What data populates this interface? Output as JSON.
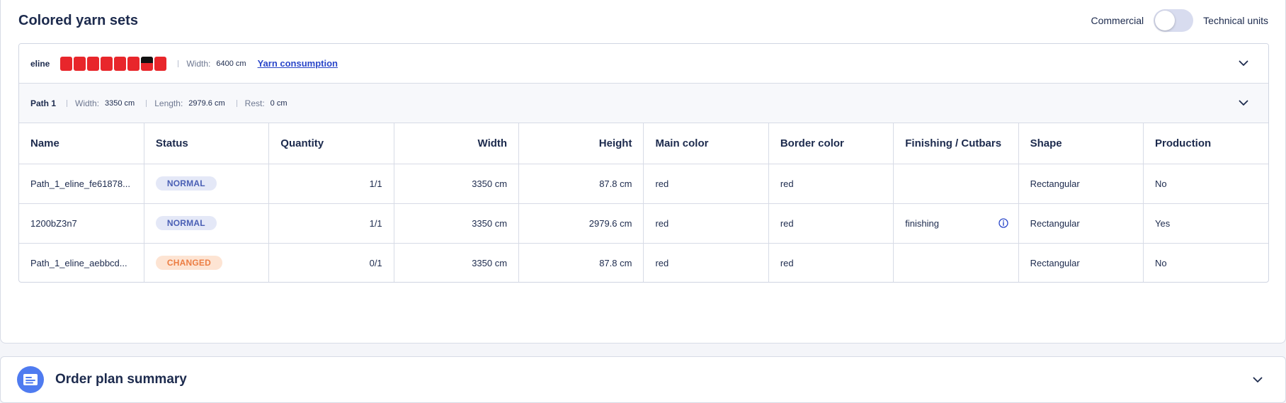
{
  "panel": {
    "title": "Colored yarn sets",
    "toggle": {
      "left_label": "Commercial",
      "right_label": "Technical units"
    }
  },
  "yarn_set": {
    "name": "eline",
    "swatches": [
      "red",
      "red",
      "red",
      "red",
      "red",
      "red",
      "black-red",
      "red"
    ],
    "width_label": "Width:",
    "width_value": "6400 cm",
    "consumption_link": "Yarn consumption"
  },
  "path": {
    "name": "Path 1",
    "width_label": "Width:",
    "width_value": "3350 cm",
    "length_label": "Length:",
    "length_value": "2979.6 cm",
    "rest_label": "Rest:",
    "rest_value": "0 cm"
  },
  "table": {
    "headers": {
      "name": "Name",
      "status": "Status",
      "quantity": "Quantity",
      "width": "Width",
      "height": "Height",
      "main_color": "Main color",
      "border_color": "Border color",
      "finishing": "Finishing / Cutbars",
      "shape": "Shape",
      "production": "Production"
    },
    "rows": [
      {
        "name": "Path_1_eline_fe61878...",
        "status": "NORMAL",
        "quantity": "1/1",
        "width": "3350 cm",
        "height": "87.8 cm",
        "main_color": "red",
        "border_color": "red",
        "finishing": "",
        "shape": "Rectangular",
        "production": "No"
      },
      {
        "name": "1200bZ3n7",
        "status": "NORMAL",
        "quantity": "1/1",
        "width": "3350 cm",
        "height": "2979.6 cm",
        "main_color": "red",
        "border_color": "red",
        "finishing": "finishing",
        "shape": "Rectangular",
        "production": "Yes"
      },
      {
        "name": "Path_1_eline_aebbcd...",
        "status": "CHANGED",
        "quantity": "0/1",
        "width": "3350 cm",
        "height": "87.8 cm",
        "main_color": "red",
        "border_color": "red",
        "finishing": "",
        "shape": "Rectangular",
        "production": "No"
      }
    ]
  },
  "summary": {
    "title": "Order plan summary"
  },
  "colors": {
    "accent": "#2a46c9",
    "swatch_red": "#e8262b",
    "normal_badge": "#e4e8f7",
    "changed_badge": "#fde4d3",
    "summary_icon": "#4f7bf0"
  }
}
